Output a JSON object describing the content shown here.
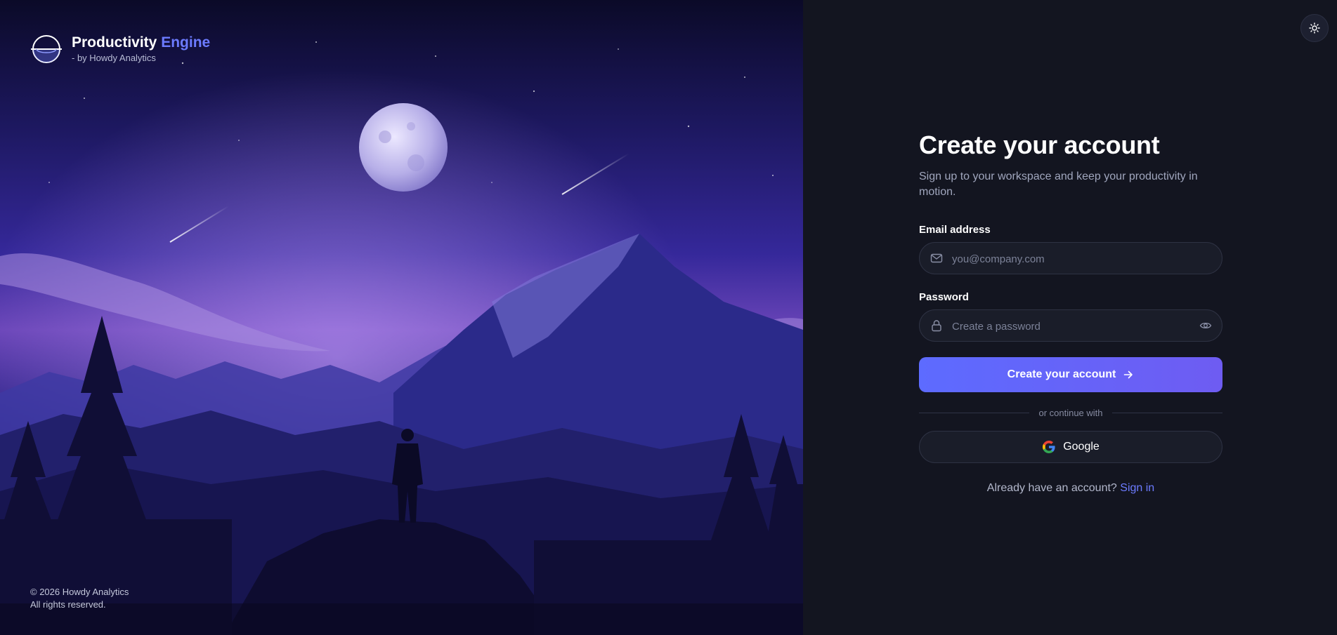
{
  "brand": {
    "name": "Productivity",
    "name_accent": "Engine",
    "tagline": "- by Howdy Analytics",
    "logo_icon": "half-moon-orbit-icon"
  },
  "footer": {
    "copyright_line1": "© 2026 Howdy Analytics",
    "copyright_line2": "All rights reserved."
  },
  "header": {
    "theme_toggle_icon": "sun-icon"
  },
  "form": {
    "title": "Create your account",
    "subtitle": "Sign up to your workspace and keep your productivity in motion.",
    "email": {
      "label": "Email address",
      "placeholder": "you@company.com",
      "value": "",
      "icon": "mail-icon"
    },
    "password": {
      "label": "Password",
      "placeholder": "Create a password",
      "value": "",
      "icon": "lock-icon",
      "toggle_icon": "eye-icon"
    },
    "submit_label": "Create your account",
    "divider_text": "or continue with",
    "google_label": "Google",
    "signin_prompt": "Already have an account?",
    "signin_link": "Sign in"
  },
  "colors": {
    "accent": "#6c7bff",
    "button_start": "#5d6bff",
    "button_end": "#6e5cf2",
    "panel_bg": "#131520",
    "input_bg": "#1a1d29"
  }
}
